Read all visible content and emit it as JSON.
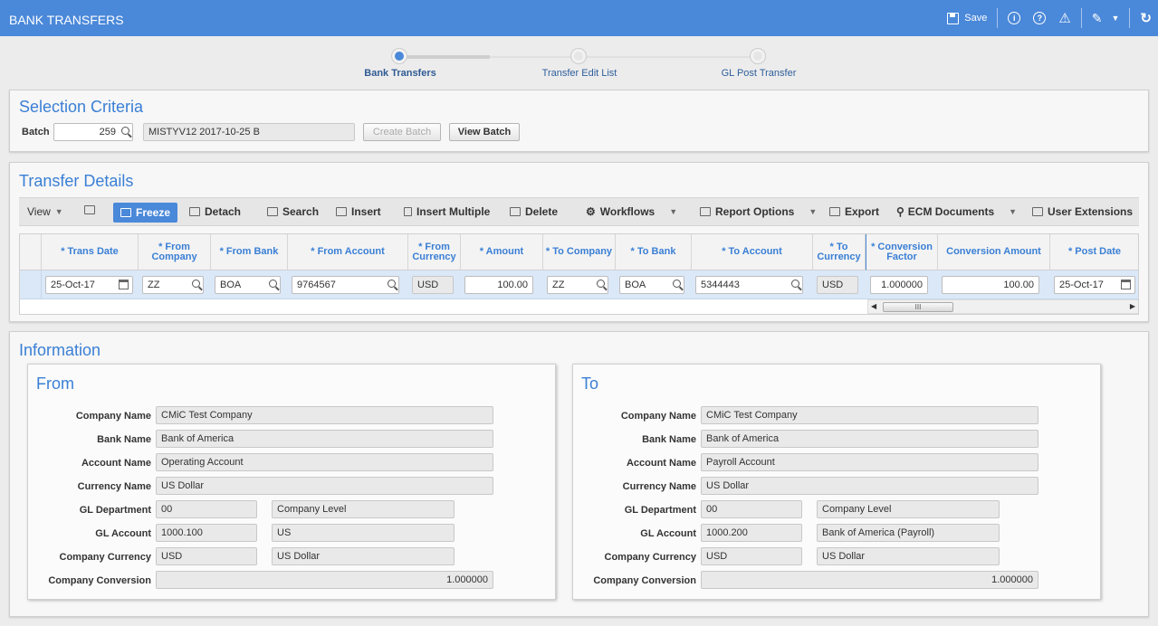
{
  "app": {
    "title": "BANK TRANSFERS"
  },
  "titlebar": {
    "save_label": "Save"
  },
  "stepper": {
    "steps": [
      {
        "label": "Bank Transfers",
        "active": true
      },
      {
        "label": "Transfer Edit List",
        "active": false
      },
      {
        "label": "GL Post Transfer",
        "active": false
      }
    ]
  },
  "selection": {
    "title": "Selection Criteria",
    "batch_label": "Batch",
    "batch_value": "259",
    "batch_desc": "MISTYV12 2017-10-25 B",
    "create_batch_label": "Create Batch",
    "view_batch_label": "View Batch"
  },
  "details": {
    "title": "Transfer Details",
    "toolbar": {
      "view": "View",
      "freeze": "Freeze",
      "detach": "Detach",
      "search": "Search",
      "insert": "Insert",
      "insert_multiple": "Insert Multiple",
      "delete": "Delete",
      "workflows": "Workflows",
      "report_options": "Report Options",
      "export": "Export",
      "ecm_documents": "ECM Documents",
      "user_extensions": "User Extensions"
    },
    "columns": [
      "* Trans Date",
      "* From Company",
      "* From Bank",
      "* From Account",
      "* From Currency",
      "* Amount",
      "* To Company",
      "* To Bank",
      "* To Account",
      "* To Currency",
      "* Conversion Factor",
      "Conversion Amount",
      "* Post Date"
    ],
    "row": {
      "trans_date": "25-Oct-17",
      "from_company": "ZZ",
      "from_bank": "BOA",
      "from_account": "9764567",
      "from_currency": "USD",
      "amount": "100.00",
      "to_company": "ZZ",
      "to_bank": "BOA",
      "to_account": "5344443",
      "to_currency": "USD",
      "conversion_factor": "1.000000",
      "conversion_amount": "100.00",
      "post_date": "25-Oct-17"
    },
    "scroll_thumb": "III"
  },
  "information": {
    "title": "Information",
    "labels": {
      "company_name": "Company Name",
      "bank_name": "Bank Name",
      "account_name": "Account Name",
      "currency_name": "Currency Name",
      "gl_department": "GL Department",
      "gl_account": "GL Account",
      "company_currency": "Company Currency",
      "company_conversion": "Company Conversion"
    },
    "from": {
      "title": "From",
      "company_name": "CMiC Test Company",
      "bank_name": "Bank of America",
      "account_name": "Operating Account",
      "currency_name": "US Dollar",
      "gl_department": "00",
      "gl_department_desc": "Company Level",
      "gl_account": "1000.100",
      "gl_account_desc": "US",
      "company_currency": "USD",
      "company_currency_desc": "US Dollar",
      "company_conversion": "1.000000"
    },
    "to": {
      "title": "To",
      "company_name": "CMiC Test Company",
      "bank_name": "Bank of America",
      "account_name": "Payroll Account",
      "currency_name": "US Dollar",
      "gl_department": "00",
      "gl_department_desc": "Company Level",
      "gl_account": "1000.200",
      "gl_account_desc": "Bank of America (Payroll)",
      "company_currency": "USD",
      "company_currency_desc": "US Dollar",
      "company_conversion": "1.000000"
    }
  },
  "colors": {
    "accent": "#4a88d9",
    "title_blue": "#3a7fd5"
  }
}
